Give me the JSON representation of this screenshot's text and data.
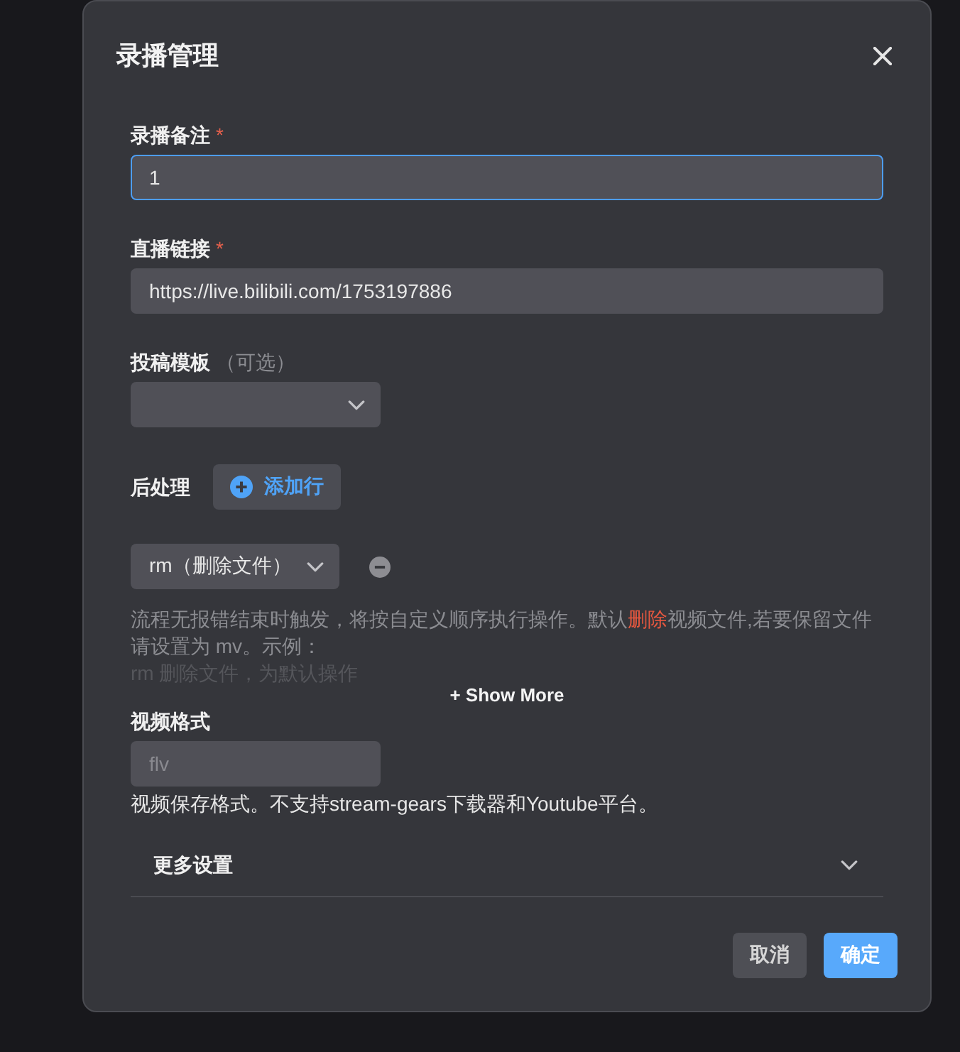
{
  "dialog": {
    "title": "录播管理"
  },
  "fields": [
    {
      "kind": "text",
      "label": "录播备注",
      "required_mark": "*",
      "value": "1",
      "focused": true
    },
    {
      "kind": "text",
      "label": "直播链接",
      "required_mark": "*",
      "value": "https://live.bilibili.com/1753197886",
      "focused": false
    },
    {
      "kind": "select",
      "label": "投稿模板",
      "note": "（可选）",
      "focused": false
    }
  ],
  "post_processing": {
    "label": "后处理",
    "add_button": "添加行",
    "steps": [
      {
        "value": "rm（删除文件）"
      }
    ],
    "help_segments": [
      {
        "kind": "plain",
        "text": "流程无报错结束时触发，将按自定义顺序执行操作。默认"
      },
      {
        "kind": "danger",
        "text": "删除"
      },
      {
        "kind": "plain",
        "text": "视频文件,若要保留文件请设置为 mv。示例："
      }
    ],
    "help_example": "rm 删除文件，为默认操作",
    "show_more": "+ Show More"
  },
  "video_format": {
    "label": "视频格式",
    "placeholder": "flv",
    "help": "视频保存格式。不支持stream-gears下载器和Youtube平台。"
  },
  "more_settings": {
    "label": "更多设置",
    "expanded": false
  },
  "buttons": [
    {
      "kind": "secondary",
      "label": "取消"
    },
    {
      "kind": "primary",
      "label": "确定"
    }
  ]
}
